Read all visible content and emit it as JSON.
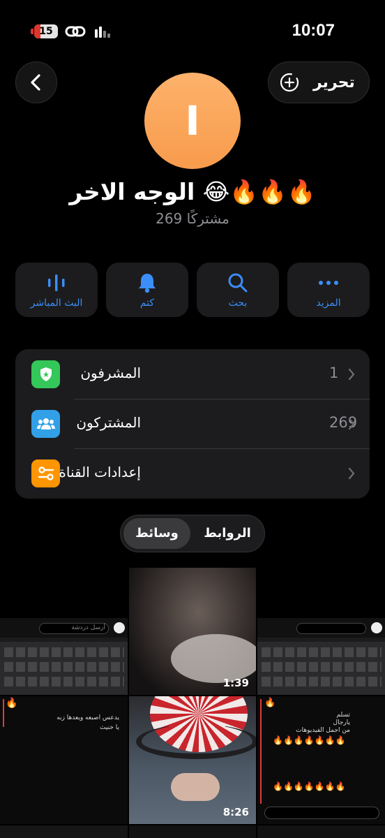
{
  "status_bar": {
    "battery": "15",
    "time": "10:07"
  },
  "header": {
    "back_icon": "chevron-left-icon",
    "edit_label": "تحرير",
    "edit_icon": "add-circle-icon"
  },
  "channel": {
    "avatar_letter": "I",
    "avatar_color": "#f9a358",
    "name": "الوجه الاخر 😂🔥🔥🔥",
    "subscribers": "269 مشتركًا"
  },
  "actions": [
    {
      "label": "المزيد",
      "icon": "more-dots-icon"
    },
    {
      "label": "بحث",
      "icon": "search-icon"
    },
    {
      "label": "كتم",
      "icon": "bell-icon"
    },
    {
      "label": "البث المباشر",
      "icon": "live-stream-icon"
    }
  ],
  "info_rows": [
    {
      "label": "المشرفون",
      "value": "1",
      "icon": "admin-shield-icon",
      "color": "#34c759"
    },
    {
      "label": "المشتركون",
      "value": "269",
      "icon": "people-icon",
      "color": "#32a0e6"
    },
    {
      "label": "إعدادات القناة",
      "value": "",
      "icon": "settings-sliders-icon",
      "color": "#ff9500"
    }
  ],
  "tabs": {
    "links": "الروابط",
    "media": "وسائط",
    "active": "media"
  },
  "media": [
    {
      "type": "screenshot"
    },
    {
      "type": "video",
      "duration": "1:39"
    },
    {
      "type": "screenshot"
    },
    {
      "type": "screenshot"
    },
    {
      "type": "video",
      "duration": "8:26"
    },
    {
      "type": "screenshot"
    }
  ],
  "chat_snippets": {
    "input_placeholder": "أرسل دردشة",
    "msg1_line1": "يدعس اصبعه ويعدها زبه",
    "msg1_line2": "يا خنيث",
    "msg2_line1": "تسلم",
    "msg2_line2": "يارجال",
    "msg2_line3": "من اجمل الفيديوهات"
  }
}
